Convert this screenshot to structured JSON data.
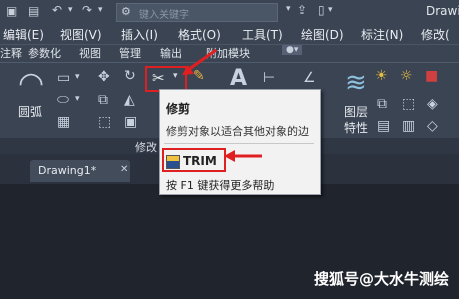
{
  "titlebar": {
    "search_placeholder": "键入关键字",
    "app_title": "Drawi"
  },
  "menubar": {
    "items": [
      "编辑(E)",
      "视图(V)",
      "插入(I)",
      "格式(O)",
      "工具(T)",
      "绘图(D)",
      "标注(N)",
      "修改("
    ]
  },
  "tabs": {
    "items": [
      "注释",
      "参数化",
      "视图",
      "管理",
      "输出",
      "附加模块"
    ]
  },
  "ribbon": {
    "arc_label": "圆弧",
    "layer_label_1": "图层",
    "layer_label_2": "特性",
    "modify_panel_label": "修改"
  },
  "tooltip": {
    "title": "修剪",
    "description": "修剪对象以适合其他对象的边",
    "command": "TRIM",
    "help": "按 F1 键获得更多帮助"
  },
  "doc_tabs": {
    "items": [
      "Drawing1*"
    ]
  },
  "watermark": "搜狐号@大水牛测绘",
  "colors": {
    "background": "#20242c",
    "ribbon": "#3b4453",
    "highlight": "#e02020",
    "tooltip_bg": "#f2f2f2"
  }
}
